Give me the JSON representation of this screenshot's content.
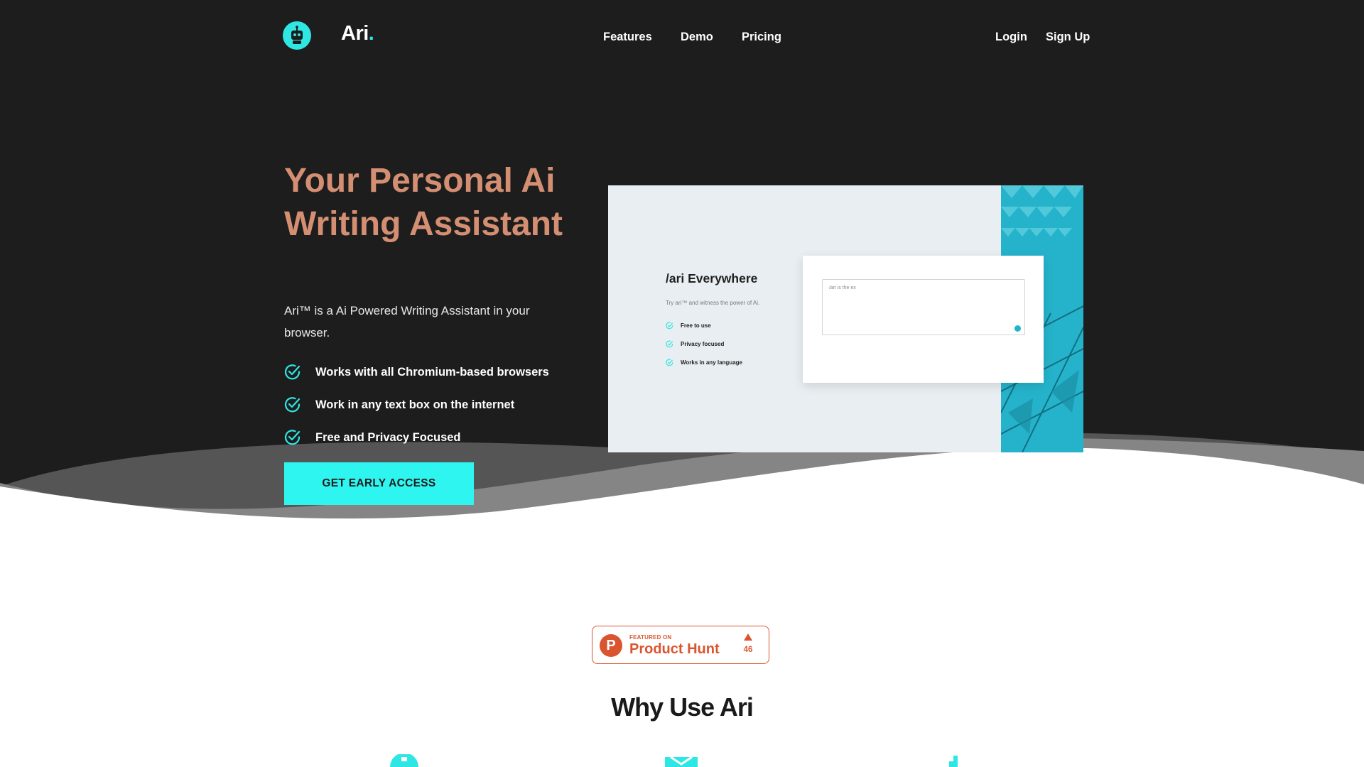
{
  "brand": {
    "name": "Ari",
    "dot": ".",
    "accent": "#2ee6e3"
  },
  "nav": {
    "links": [
      "Features",
      "Demo",
      "Pricing"
    ],
    "login": "Login",
    "signup": "Sign Up"
  },
  "hero": {
    "title": "Your Personal Ai Writing Assistant",
    "description": "Ari™ is a Ai Powered Writing Assistant in your browser.",
    "features": [
      "Works with all Chromium-based browsers",
      "Work in any text box on the internet",
      "Free and Privacy Focused"
    ],
    "cta": "GET EARLY ACCESS",
    "title_color": "#d48e72",
    "background": "#1d1d1d"
  },
  "mockup": {
    "title": "/ari Everywhere",
    "subtitle": "Try ari™ and witness the power of Ai.",
    "items": [
      "Free to use",
      "Privacy focused",
      "Works in any language"
    ],
    "textbox_value": "/ari is the ex"
  },
  "product_hunt": {
    "featured_label": "FEATURED ON",
    "name": "Product Hunt",
    "votes": "46",
    "color": "#da552f"
  },
  "why": {
    "title": "Why Use Ari"
  }
}
